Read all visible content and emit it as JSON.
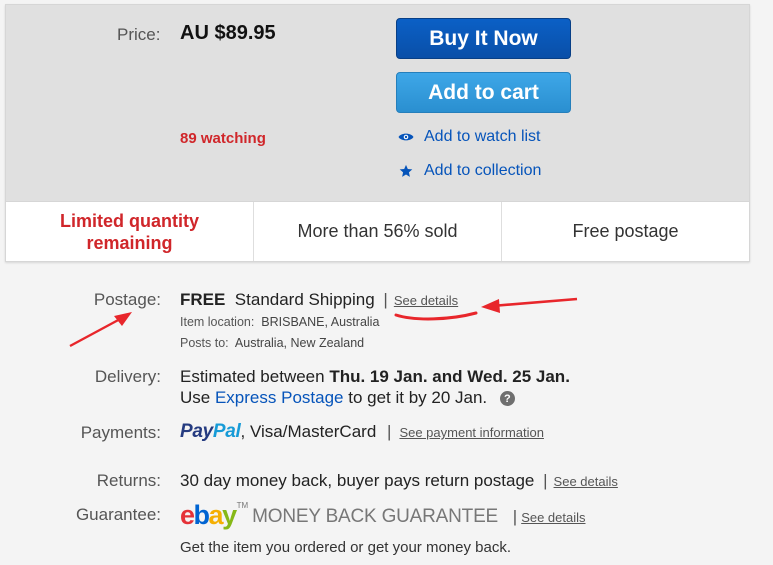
{
  "buy_box": {
    "price_label": "Price:",
    "price_value": "AU $89.95",
    "buy_now_label": "Buy It Now",
    "add_to_cart_label": "Add to cart",
    "watching_text": "89 watching",
    "watch_list_label": "Add to watch list",
    "collection_label": "Add to collection",
    "features": [
      "Limited quantity remaining",
      "More than 56% sold",
      "Free postage"
    ]
  },
  "postage": {
    "label": "Postage:",
    "free": "FREE",
    "service": "Standard Shipping",
    "separator": "|",
    "see_details": "See details",
    "item_location_label": "Item location:",
    "item_location_value": "BRISBANE, Australia",
    "posts_to_label": "Posts to:",
    "posts_to_value": "Australia, New Zealand"
  },
  "delivery": {
    "label": "Delivery:",
    "line1_prefix": "Estimated between",
    "line1_dates": "Thu. 19 Jan. and Wed. 25 Jan.",
    "line2_prefix": "Use",
    "express_link": "Express Postage",
    "line2_suffix": "to get it by 20 Jan.",
    "help_icon_glyph": "?"
  },
  "payments": {
    "label": "Payments:",
    "paypal_part1": "Pay",
    "paypal_part2": "Pal",
    "methods": ", Visa/MasterCard",
    "separator": "|",
    "see_payment_info": "See payment information"
  },
  "returns": {
    "label": "Returns:",
    "text": "30 day money back, buyer pays return postage",
    "separator": "|",
    "see_details": "See details"
  },
  "guarantee": {
    "label": "Guarantee:",
    "logo_e": "e",
    "logo_b": "b",
    "logo_a": "a",
    "logo_y": "y",
    "tm": "TM",
    "mbg_text": "MONEY BACK GUARANTEE",
    "separator": "|",
    "see_details": "See details",
    "tagline": "Get the item you ordered or get your money back."
  },
  "colors": {
    "buy_now_bg": "#0a4fa8",
    "add_to_cart_bg": "#2a8fd0",
    "watching_red": "#d0262a",
    "link_blue": "#0654ba",
    "annotation_red": "#e8262b"
  }
}
